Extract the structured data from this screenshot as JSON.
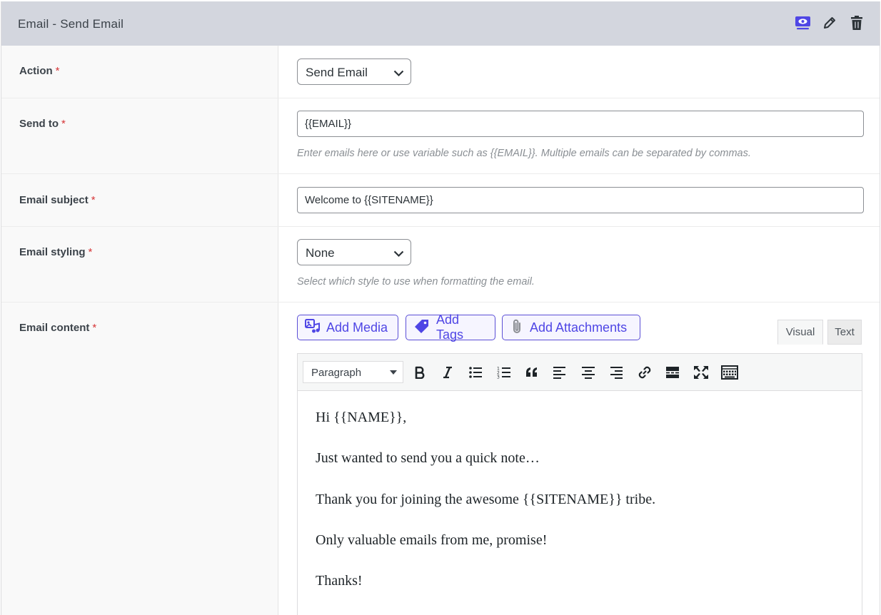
{
  "header": {
    "title": "Email - Send Email",
    "icons": [
      "preview-icon",
      "edit-icon",
      "trash-icon"
    ],
    "accent_color": "#4f46e5"
  },
  "fields": {
    "action": {
      "label": "Action",
      "required": "*",
      "value": "Send Email"
    },
    "send_to": {
      "label": "Send to",
      "required": "*",
      "value": "{{EMAIL}}",
      "help": "Enter emails here or use variable such as {{EMAIL}}. Multiple emails can be separated by commas."
    },
    "subject": {
      "label": "Email subject",
      "required": "*",
      "value": "Welcome to {{SITENAME}}"
    },
    "styling": {
      "label": "Email styling",
      "required": "*",
      "value": "None",
      "help": "Select which style to use when formatting the email."
    },
    "content": {
      "label": "Email content",
      "required": "*"
    }
  },
  "media_buttons": {
    "add_media": "Add Media",
    "add_tags": "Add Tags",
    "add_attachments": "Add Attachments"
  },
  "editor": {
    "tabs": {
      "visual": "Visual",
      "text": "Text"
    },
    "format_select": "Paragraph",
    "toolbar_icons": [
      "bold-icon",
      "italic-icon",
      "bullet-list-icon",
      "numbered-list-icon",
      "blockquote-icon",
      "align-left-icon",
      "align-center-icon",
      "align-right-icon",
      "link-icon",
      "read-more-icon",
      "fullscreen-icon",
      "toolbar-toggle-icon"
    ],
    "paragraphs": [
      "Hi {{NAME}},",
      "Just wanted to send you a quick note…",
      "Thank you for joining the awesome {{SITENAME}} tribe.",
      "Only valuable emails from me, promise!",
      "Thanks!"
    ]
  }
}
